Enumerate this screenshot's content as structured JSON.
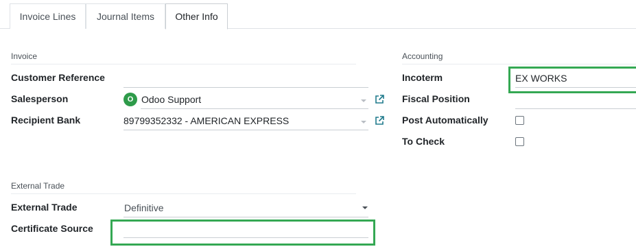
{
  "tabs": [
    {
      "label": "Invoice Lines"
    },
    {
      "label": "Journal Items"
    },
    {
      "label": "Other Info"
    }
  ],
  "invoice": {
    "title": "Invoice",
    "customer_reference_label": "Customer Reference",
    "customer_reference_value": "",
    "salesperson_label": "Salesperson",
    "salesperson_initial": "O",
    "salesperson_value": "Odoo Support",
    "recipient_bank_label": "Recipient Bank",
    "recipient_bank_value": "89799352332 - AMERICAN EXPRESS"
  },
  "accounting": {
    "title": "Accounting",
    "incoterm_label": "Incoterm",
    "incoterm_value": "EX WORKS",
    "fiscal_position_label": "Fiscal Position",
    "fiscal_position_value": "",
    "post_automatically_label": "Post Automatically",
    "post_automatically_checked": false,
    "to_check_label": "To Check",
    "to_check_checked": false
  },
  "external_trade": {
    "title": "External Trade",
    "external_trade_label": "External Trade",
    "external_trade_value": "Definitive",
    "certificate_source_label": "Certificate Source",
    "certificate_source_value": ""
  },
  "colors": {
    "highlight": "#34a853",
    "avatar": "#2e9b4a",
    "external_link": "#1f7a8c"
  },
  "icons": {
    "external_link": "external-link-icon",
    "dropdown": "chevron-down-icon"
  }
}
